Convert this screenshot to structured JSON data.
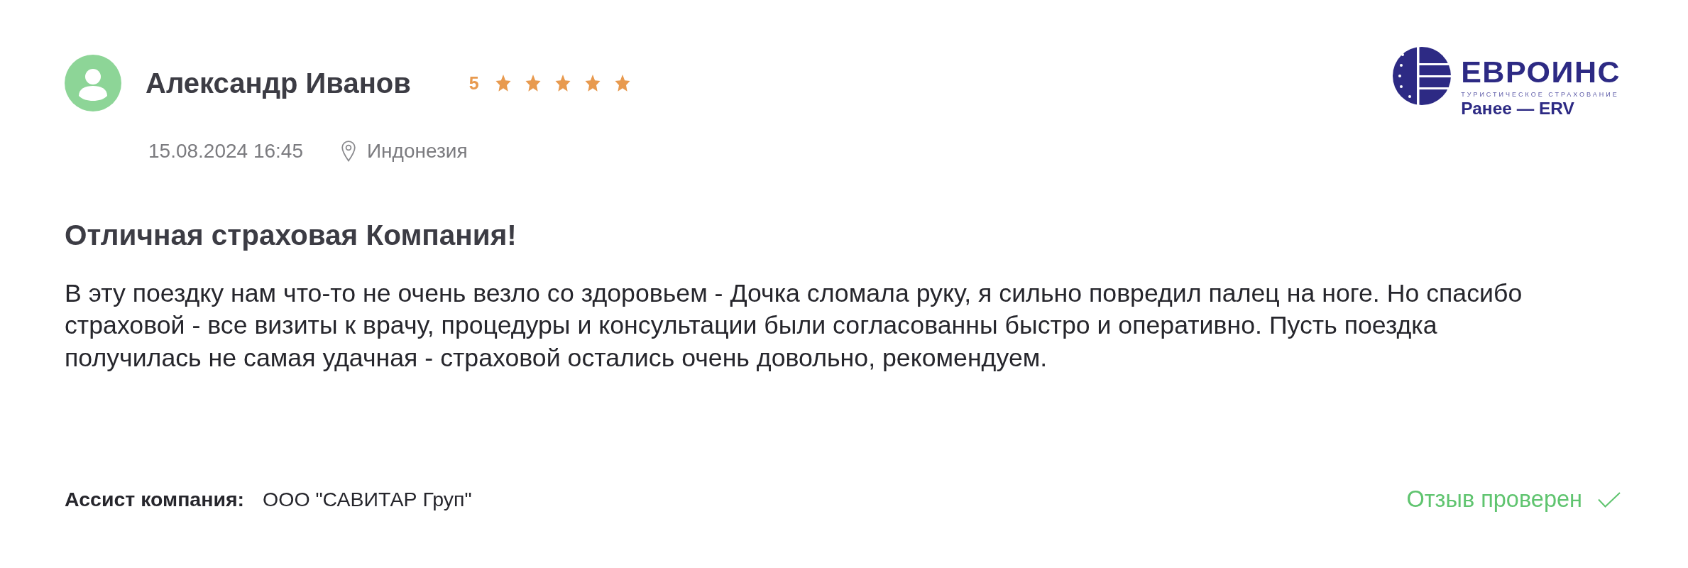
{
  "review": {
    "author": {
      "name": "Александр Иванов"
    },
    "rating": {
      "score": "5",
      "stars": 5
    },
    "date": "15.08.2024 16:45",
    "location": "Индонезия",
    "company_logo": {
      "name": "ЕВРОИНС",
      "tagline": "ТУРИСТИЧЕСКОЕ СТРАХОВАНИЕ",
      "note": "Ранее — ERV"
    },
    "title": "Отличная страховая Компания!",
    "body": "В эту поездку нам что-то не очень везло со здоровьем - Дочка сломала руку, я сильно повредил палец на ноге. Но спасибо страховой - все визиты к врачу, процедуры и консультации были согласованны быстро и оперативно. Пусть поездка получилась не самая удачная - страховой остались очень довольно, рекомендуем.",
    "assist": {
      "label": "Ассист компания:",
      "value": "ООО \"САВИТАР Груп\""
    },
    "verified": {
      "label": "Отзыв проверен"
    }
  }
}
